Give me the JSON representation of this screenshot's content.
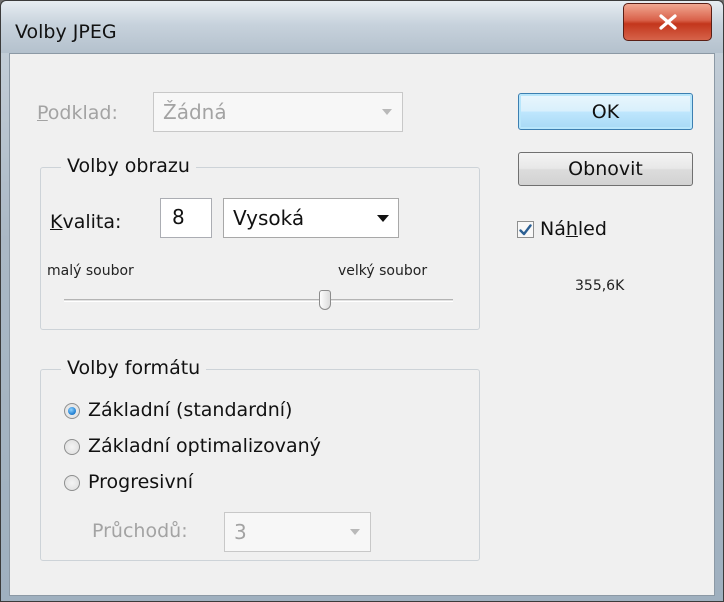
{
  "window": {
    "title": "Volby JPEG"
  },
  "matte": {
    "label": "Podklad:",
    "value": "Žádná"
  },
  "image_options": {
    "group_title": "Volby obrazu",
    "quality_label": "Kvalita:",
    "quality_value": "8",
    "quality_preset": "Vysoká",
    "small_file_label": "malý soubor",
    "large_file_label": "velký soubor",
    "slider_fraction": 0.67
  },
  "format_options": {
    "group_title": "Volby formátu",
    "options": [
      {
        "label": "Základní (standardní)",
        "selected": true
      },
      {
        "label": "Základní optimalizovaný",
        "selected": false
      },
      {
        "label": "Progresivní",
        "selected": false
      }
    ],
    "scans_label": "Průchodů:",
    "scans_value": "3"
  },
  "buttons": {
    "ok": "OK",
    "reset": "Obnovit"
  },
  "preview": {
    "label": "Náhled",
    "checked": true,
    "file_size": "355,6K"
  },
  "colors": {
    "default_button_border": "#3c7fb1",
    "close_button": "#c3361c",
    "dialog_background": "#f0f0f0"
  }
}
